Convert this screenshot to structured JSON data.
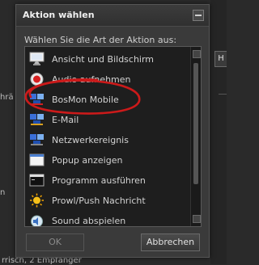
{
  "background": {
    "left_snippet_1": "hrä",
    "left_snippet_2": "n",
    "right_button_label": "H",
    "bottom_text": "rrisch, 2 Empfänger"
  },
  "dialog": {
    "title": "Aktion wählen",
    "prompt": "Wählen Sie die Art der Aktion aus:",
    "items": [
      {
        "label": "Ansicht und Bildschirm",
        "icon": "monitor-icon"
      },
      {
        "label": "Audio aufnehmen",
        "icon": "record-icon"
      },
      {
        "label": "BosMon Mobile",
        "icon": "mobile-network-icon"
      },
      {
        "label": "E-Mail",
        "icon": "email-network-icon"
      },
      {
        "label": "Netzwerkereignis",
        "icon": "network-icon"
      },
      {
        "label": "Popup anzeigen",
        "icon": "popup-icon"
      },
      {
        "label": "Programm ausführen",
        "icon": "console-icon"
      },
      {
        "label": "Prowl/Push Nachricht",
        "icon": "sun-icon"
      },
      {
        "label": "Sound abspielen",
        "icon": "speaker-icon"
      }
    ],
    "ok_label": "OK",
    "cancel_label": "Abbrechen"
  },
  "colors": {
    "annotation": "#cc1a1a",
    "background": "#2a2a2a",
    "dialog": "#3a3a3a",
    "list": "#1e1e1e"
  }
}
